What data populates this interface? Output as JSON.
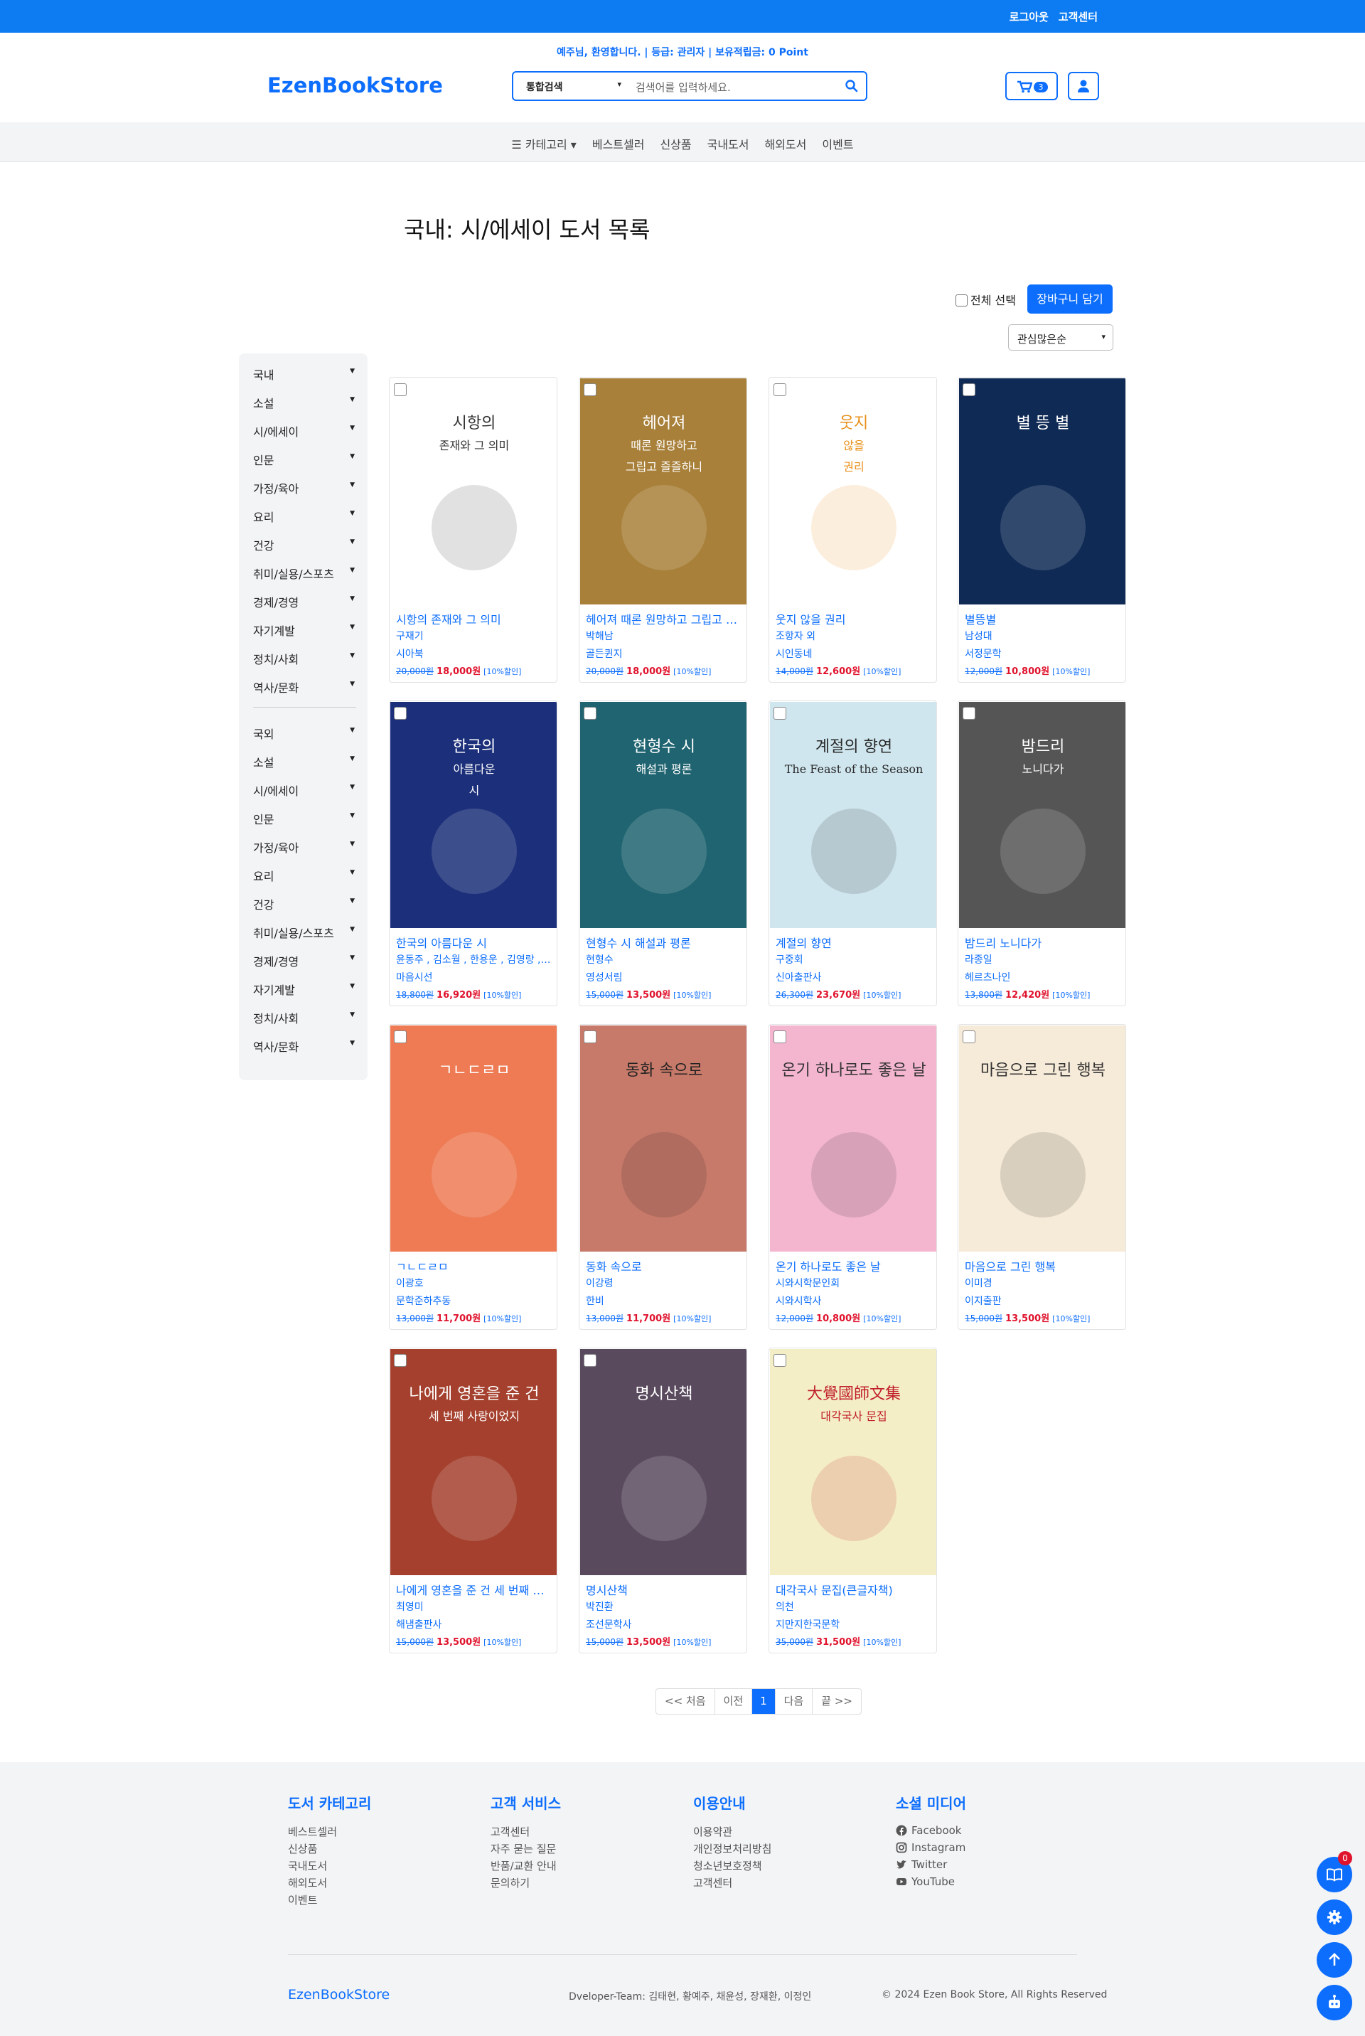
{
  "header": {
    "top_links": [
      "로그아웃",
      "고객센터"
    ],
    "welcome": "예주님, 환영합니다. | 등급: 관리자 | 보유적립금: 0 Point",
    "brand": "EzenBookStore",
    "search_category": "통합검색",
    "search_placeholder": "검색어를 입력하세요.",
    "cart_count": "3"
  },
  "nav": {
    "items": [
      "☰ 카테고리 ▾",
      "베스트셀러",
      "신상품",
      "국내도서",
      "해외도서",
      "이벤트"
    ]
  },
  "page": {
    "title": "국내: 시/에세이 도서 목록",
    "select_all": "전체 선택",
    "add_cart": "장바구니 담기",
    "sort": "관심많은순"
  },
  "sidebar": {
    "domestic": [
      "국내",
      "소설",
      "시/에세이",
      "인문",
      "가정/육아",
      "요리",
      "건강",
      "취미/실용/스포츠",
      "경제/경영",
      "자기계발",
      "정치/사회",
      "역사/문화"
    ],
    "foreign": [
      "국외",
      "소설",
      "시/에세이",
      "인문",
      "가정/육아",
      "요리",
      "건강",
      "취미/실용/스포츠",
      "경제/경영",
      "자기계발",
      "정치/사회",
      "역사/문화"
    ]
  },
  "colors": {
    "accent": "#0d6efd",
    "sale": "#e0132d",
    "topbar": "#0d7cf2"
  },
  "books": [
    {
      "title": "시항의 존재와 그 의미",
      "author": "구재기",
      "publisher": "시아북",
      "orig": "20,000원",
      "sale": "18,000원",
      "disc": "[10%할인]",
      "cover_text": [
        "시항의",
        "존재와 그 의미"
      ],
      "bg": "#ffffff",
      "fg": "#333333"
    },
    {
      "title": "헤어져 때론 원망하고 그립고 …",
      "author": "박해남",
      "publisher": "골든퀸지",
      "orig": "20,000원",
      "sale": "18,000원",
      "disc": "[10%할인]",
      "cover_text": [
        "헤어져",
        "때론 원망하고",
        "그립고 즐즐하니"
      ],
      "bg": "#a8803a",
      "fg": "#ffffff"
    },
    {
      "title": "웃지 않을 권리",
      "author": "조항자 외",
      "publisher": "시인동네",
      "orig": "14,000원",
      "sale": "12,600원",
      "disc": "[10%할인]",
      "cover_text": [
        "웃지",
        "않을",
        "권리"
      ],
      "bg": "#ffffff",
      "fg": "#e8901a"
    },
    {
      "title": "별뜽별",
      "author": "남성대",
      "publisher": "서정문학",
      "orig": "12,000원",
      "sale": "10,800원",
      "disc": "[10%할인]",
      "cover_text": [
        "별 뜽 별"
      ],
      "bg": "#0f2a55",
      "fg": "#ffffff"
    },
    {
      "title": "한국의 아름다운 시",
      "author": "윤동주 , 김소월 , 한용운 , 김영랑 , 이육…",
      "publisher": "마음시선",
      "orig": "18,800원",
      "sale": "16,920원",
      "disc": "[10%할인]",
      "cover_text": [
        "한국의",
        "아름다운",
        "시"
      ],
      "bg": "#1c2f7a",
      "fg": "#ffffff"
    },
    {
      "title": "현형수 시 해설과 평론",
      "author": "현형수",
      "publisher": "영성서림",
      "orig": "15,000원",
      "sale": "13,500원",
      "disc": "[10%할인]",
      "cover_text": [
        "현형수 시",
        "해설과 평론"
      ],
      "bg": "#1f6470",
      "fg": "#ffffff"
    },
    {
      "title": "계절의 향연",
      "author": "구중회",
      "publisher": "신아출판사",
      "orig": "26,300원",
      "sale": "23,670원",
      "disc": "[10%할인]",
      "cover_text": [
        "계절의 향연",
        "The Feast of the Season"
      ],
      "bg": "#cfe6ee",
      "fg": "#2a2a2a"
    },
    {
      "title": "밤드리 노니다가",
      "author": "라종일",
      "publisher": "헤르츠나인",
      "orig": "13,800원",
      "sale": "12,420원",
      "disc": "[10%할인]",
      "cover_text": [
        "밤드리",
        "노니다가"
      ],
      "bg": "#555555",
      "fg": "#ffffff"
    },
    {
      "title": "ㄱㄴㄷㄹㅁ",
      "author": "이광호",
      "publisher": "문학준하추동",
      "orig": "13,000원",
      "sale": "11,700원",
      "disc": "[10%할인]",
      "cover_text": [
        "ㄱㄴㄷㄹㅁ"
      ],
      "bg": "#ee7b54",
      "fg": "#ffffff"
    },
    {
      "title": "동화 속으로",
      "author": "이강령",
      "publisher": "한비",
      "orig": "13,000원",
      "sale": "11,700원",
      "disc": "[10%할인]",
      "cover_text": [
        "동화 속으로"
      ],
      "bg": "#c87a6a",
      "fg": "#222222"
    },
    {
      "title": "온기 하나로도 좋은 날",
      "author": "시와시학문인회",
      "publisher": "시와시학사",
      "orig": "12,000원",
      "sale": "10,800원",
      "disc": "[10%할인]",
      "cover_text": [
        "온기 하나로도 좋은 날"
      ],
      "bg": "#f4b6cf",
      "fg": "#333333"
    },
    {
      "title": "마음으로 그린 행복",
      "author": "이미경",
      "publisher": "이지출판",
      "orig": "15,000원",
      "sale": "13,500원",
      "disc": "[10%할인]",
      "cover_text": [
        "마음으로 그린 행복"
      ],
      "bg": "#f6ead8",
      "fg": "#333333"
    },
    {
      "title": "나에게 영혼을 준 건 세 번째 사…",
      "author": "최영미",
      "publisher": "해냄출판사",
      "orig": "15,000원",
      "sale": "13,500원",
      "disc": "[10%할인]",
      "cover_text": [
        "나에게 영혼을 준 건",
        "세 번째 사랑이었지"
      ],
      "bg": "#a4402d",
      "fg": "#ffffff"
    },
    {
      "title": "명시산책",
      "author": "박진환",
      "publisher": "조선문학사",
      "orig": "15,000원",
      "sale": "13,500원",
      "disc": "[10%할인]",
      "cover_text": [
        "명시산책"
      ],
      "bg": "#5a4a5e",
      "fg": "#ffffff"
    },
    {
      "title": "대각국사 문집(큰글자책)",
      "author": "의천",
      "publisher": "지만지한국문학",
      "orig": "35,000원",
      "sale": "31,500원",
      "disc": "[10%할인]",
      "cover_text": [
        "大覺國師文集",
        "대각국사 문집"
      ],
      "bg": "#f4eec6",
      "fg": "#c0202a"
    }
  ],
  "pager": {
    "first": "<< 처음",
    "prev": "이전",
    "current": "1",
    "next": "다음",
    "last": "끝 >>"
  },
  "footer": {
    "cols": [
      {
        "heading": "도서 카테고리",
        "links": [
          "베스트셀러",
          "신상품",
          "국내도서",
          "해외도서",
          "이벤트"
        ]
      },
      {
        "heading": "고객 서비스",
        "links": [
          "고객센터",
          "자주 묻는 질문",
          "반품/교환 안내",
          "문의하기"
        ]
      },
      {
        "heading": "이용안내",
        "links": [
          "이용약관",
          "개인정보처리방침",
          "청소년보호정책",
          "고객센터"
        ]
      },
      {
        "heading": "소셜 미디어",
        "links": [
          "Facebook",
          "Instagram",
          "Twitter",
          "YouTube"
        ]
      }
    ],
    "brand": "EzenBookStore",
    "team": "Dveloper-Team: 김태현, 황예주, 채윤성, 장재환, 이정인",
    "copyright": "© 2024 Ezen Book Store, All Rights Reserved"
  },
  "fab": {
    "book_badge": "0"
  }
}
